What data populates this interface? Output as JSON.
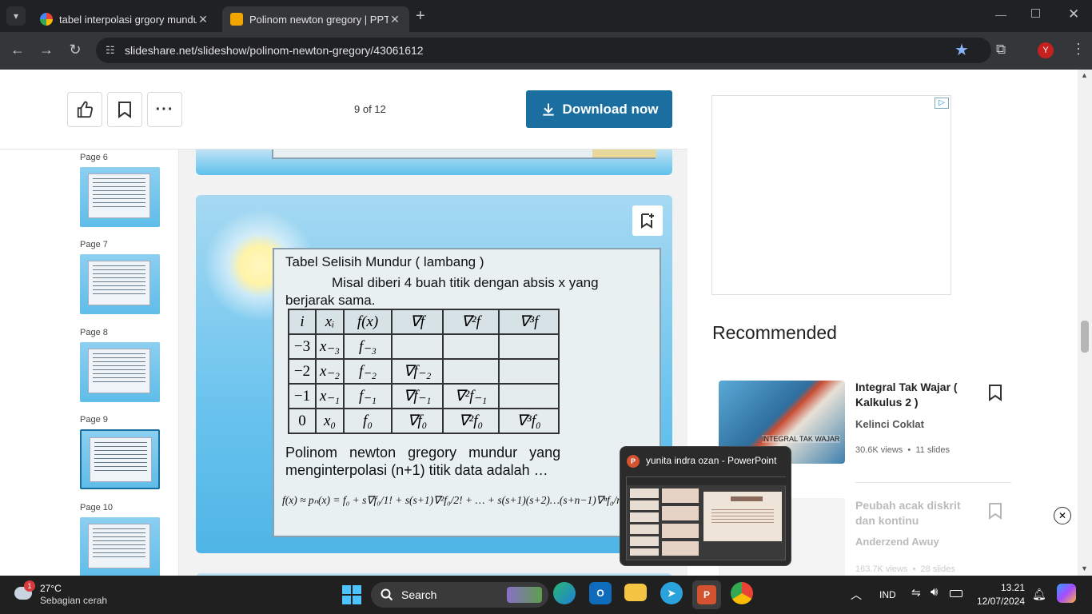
{
  "browser": {
    "tabs": [
      {
        "title": "tabel interpolasi grgory mundur",
        "active": false
      },
      {
        "title": "Polinom newton gregory | PPT",
        "active": true
      }
    ],
    "url": "slideshare.net/slideshow/polinom-newton-gregory/43061612",
    "profile_initial": "Y"
  },
  "toolbar": {
    "page_counter": "9 of 12",
    "download_label": "Download now"
  },
  "sidebar": {
    "pages": [
      "Page 6",
      "Page 7",
      "Page 8",
      "Page 9",
      "Page 10"
    ],
    "selected": "Page 9"
  },
  "slide": {
    "heading": "Tabel Selisih Mundur ( lambang    )",
    "intro_line1": "Misal diberi 4 buah titik dengan absis x yang",
    "intro_line2": "berjarak sama.",
    "table": {
      "headers": [
        "i",
        "xᵢ",
        "f(x)",
        "∇f",
        "∇²f",
        "∇³f"
      ],
      "rows": [
        [
          "−3",
          "x₋₃",
          "f₋₃",
          "",
          "",
          ""
        ],
        [
          "−2",
          "x₋₂",
          "f₋₂",
          "∇f₋₂",
          "",
          ""
        ],
        [
          "−1",
          "x₋₁",
          "f₋₁",
          "∇f₋₁",
          "∇²f₋₁",
          ""
        ],
        [
          "0",
          "x₀",
          "f₀",
          "∇f₀",
          "∇²f₀",
          "∇³f₀"
        ]
      ]
    },
    "poly_line1": "Polinom   newton   gregory   mundur   yang",
    "poly_line2": "menginterpolasi (n+1) titik data adalah …",
    "formula": "f(x) ≈ pₙ(x) = f₀ + s∇f₀/1! + s(s+1)∇²f₀/2! + … + s(s+1)(s+2)…(s+n−1)∇ⁿf₀/n!"
  },
  "recommended": {
    "heading": "Recommended",
    "items": [
      {
        "title": "Integral Tak Wajar ( Kalkulus 2 )",
        "author": "Kelinci Coklat",
        "meta": "30.6K views  •  11 slides",
        "thumb_text": "INTEGRAL TAK WAJAR"
      },
      {
        "title": "Peubah acak diskrit dan kontinu",
        "author": "Anderzend Awuy",
        "meta": "163.7K views  •  28 slides",
        "thumb_text": ""
      }
    ]
  },
  "popup": {
    "title": "yunita indra ozan - PowerPoint"
  },
  "taskbar": {
    "weather_temp": "27°C",
    "weather_desc": "Sebagian cerah",
    "weather_badge": "1",
    "search_label": "Search",
    "lang": "IND",
    "time": "13.21",
    "date": "12/07/2024"
  },
  "colors": {
    "download_button": "#1b6fa0",
    "browser_chrome": "#202124"
  }
}
